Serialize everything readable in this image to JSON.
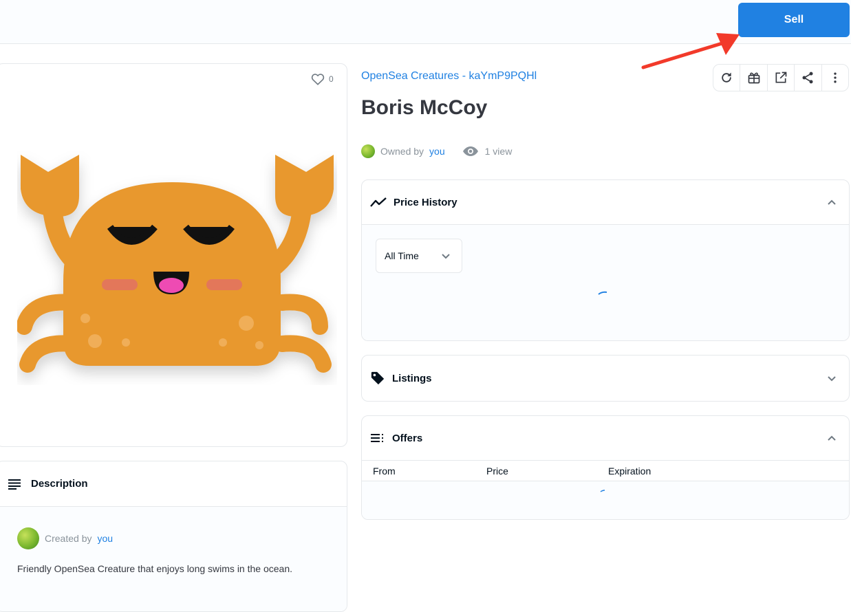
{
  "header": {
    "sell_label": "Sell"
  },
  "item": {
    "collection": "OpenSea Creatures - kaYmP9PQHl",
    "title": "Boris McCoy",
    "favorites": "0",
    "owned_by_prefix": "Owned by",
    "owner": "you",
    "views": "1 view"
  },
  "toolbar": {
    "icons": [
      "refresh-icon",
      "gift-icon",
      "external-link-icon",
      "share-icon",
      "more-icon"
    ]
  },
  "description": {
    "title": "Description",
    "created_by_prefix": "Created by",
    "creator": "you",
    "text": "Friendly OpenSea Creature that enjoys long swims in the ocean."
  },
  "price_history": {
    "title": "Price History",
    "range": "All Time"
  },
  "listings": {
    "title": "Listings"
  },
  "offers": {
    "title": "Offers",
    "columns": [
      "From",
      "Price",
      "Expiration"
    ]
  },
  "colors": {
    "accent": "#2081e2",
    "creature": "#e8982e",
    "annotation_arrow": "#f23a2a"
  }
}
